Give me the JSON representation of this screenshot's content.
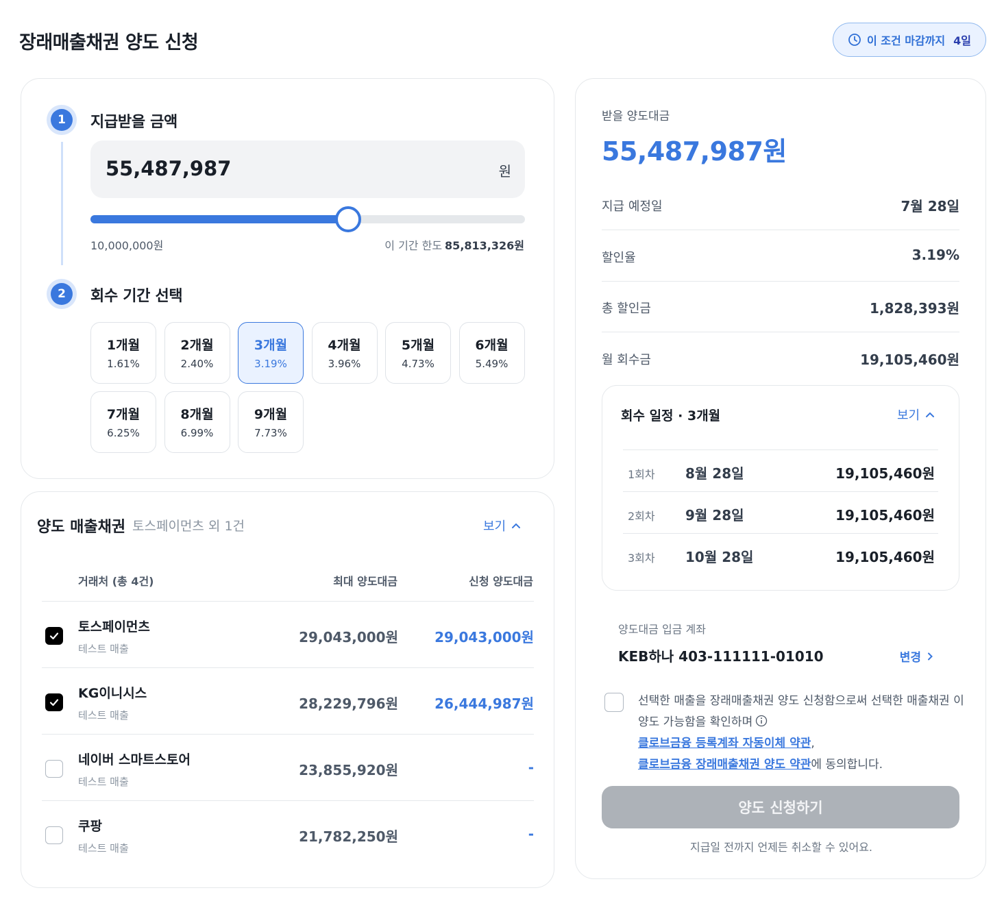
{
  "header": {
    "title": "장래매출채권 양도 신청",
    "deadline_label": "이 조건 마감까지",
    "deadline_days": "4일"
  },
  "step1": {
    "number": "1",
    "title": "지급받을 금액",
    "amount": "55,487,987",
    "unit": "원",
    "slider_min": "10,000,000원",
    "slider_max_label": "이 기간 한도",
    "slider_max_value": "85,813,326원",
    "slider_fraction": 0.5935
  },
  "step2": {
    "number": "2",
    "title": "회수 기간 선택",
    "periods": [
      {
        "months": "1개월",
        "rate": "1.61%"
      },
      {
        "months": "2개월",
        "rate": "2.40%"
      },
      {
        "months": "3개월",
        "rate": "3.19%"
      },
      {
        "months": "4개월",
        "rate": "3.96%"
      },
      {
        "months": "5개월",
        "rate": "4.73%"
      },
      {
        "months": "6개월",
        "rate": "5.49%"
      },
      {
        "months": "7개월",
        "rate": "6.25%"
      },
      {
        "months": "8개월",
        "rate": "6.99%"
      },
      {
        "months": "9개월",
        "rate": "7.73%"
      }
    ],
    "selected_index": 2
  },
  "receivables": {
    "title": "양도 매출채권",
    "subtitle": "토스페이먼츠 외 1건",
    "toggle_label": "보기",
    "columns": {
      "client": "거래처 (총 4건)",
      "max": "최대 양도대금",
      "requested": "신청 양도대금"
    },
    "rows": [
      {
        "name": "토스페이먼츠",
        "tag": "테스트 매출",
        "max": "29,043,000원",
        "requested": "29,043,000원",
        "checked": true
      },
      {
        "name": "KG이니시스",
        "tag": "테스트 매출",
        "max": "28,229,796원",
        "requested": "26,444,987원",
        "checked": true
      },
      {
        "name": "네이버 스마트스토어",
        "tag": "테스트 매출",
        "max": "23,855,920원",
        "requested": "-",
        "checked": false
      },
      {
        "name": "쿠팡",
        "tag": "테스트 매출",
        "max": "21,782,250원",
        "requested": "-",
        "checked": false
      }
    ]
  },
  "summary": {
    "label": "받을 양도대금",
    "amount": "55,487,987원",
    "items": [
      {
        "key": "지급 예정일",
        "value": "7월 28일"
      },
      {
        "key": "할인율",
        "value": "3.19%"
      },
      {
        "key": "총 할인금",
        "value": "1,828,393원"
      },
      {
        "key": "월 회수금",
        "value": "19,105,460원"
      }
    ],
    "schedule": {
      "title": "회수 일정 · 3개월",
      "toggle_label": "보기",
      "rows": [
        {
          "n": "1회차",
          "date": "8월 28일",
          "amount": "19,105,460원"
        },
        {
          "n": "2회차",
          "date": "9월 28일",
          "amount": "19,105,460원"
        },
        {
          "n": "3회차",
          "date": "10월 28일",
          "amount": "19,105,460원"
        }
      ]
    },
    "account_label": "양도대금 입금 계좌",
    "account_value": "KEB하나 403-111111-01010",
    "change_label": "변경",
    "agree_text_1": "선택한 매출을 장래매출채권 양도 신청함으로써 선택한 매출채권 이 양도 가능함을 확인하며",
    "agree_link_1": "클로브금융 등록계좌 자동이체 약관",
    "agree_sep": ",",
    "agree_link_2": "클로브금융 장래매출채권 양도 약관",
    "agree_text_2": "에 동의합니다.",
    "submit_label": "양도 신청하기",
    "cancel_note": "지급일 전까지 언제든 취소할 수 있어요."
  },
  "colors": {
    "accent": "#3a78de",
    "disabled_button": "#adb2b8"
  }
}
